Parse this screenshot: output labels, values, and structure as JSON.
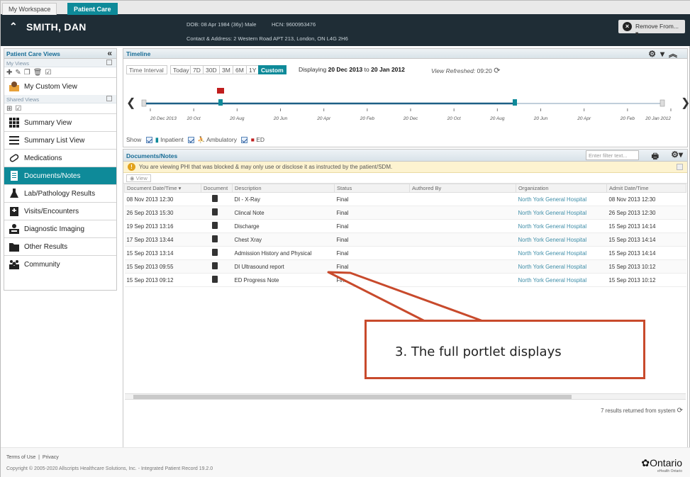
{
  "tabs": [
    "My Workspace",
    "Patient Care"
  ],
  "patient": {
    "name": "SMITH, DAN",
    "demo": "DOB:  08 Apr 1984 (36y)  Male",
    "hcn": "HCN:  9600953476",
    "address": "Contact & Address:  2 Western Road APT 213, London, ON L4G 2H6",
    "remove_label": "Remove From..."
  },
  "left": {
    "title": "Patient Care Views",
    "my_views": "My Views",
    "my_custom_view": "My Custom View",
    "shared_views": "Shared Views",
    "items": [
      "Summary View",
      "Summary List View",
      "Medications",
      "Documents/Notes",
      "Lab/Pathology Results",
      "Visits/Encounters",
      "Diagnostic Imaging",
      "Other Results",
      "Community"
    ]
  },
  "timeline": {
    "title": "Timeline",
    "interval_label": "Time Interval",
    "buttons": [
      "Today",
      "7D",
      "30D",
      "3M",
      "6M",
      "1Y",
      "Custom"
    ],
    "display_prefix": "Displaying",
    "date_from": "20 Dec 2013",
    "display_to": "to",
    "date_to": "20 Jan 2012",
    "refreshed_label": "View Refreshed:",
    "refreshed_time": "09:20",
    "ticks": [
      "20 Dec 2013",
      "20 Oct",
      "20 Aug",
      "20 Jun",
      "20 Apr",
      "20 Feb",
      "20 Dec",
      "20 Oct",
      "20 Aug",
      "20 Jun",
      "20 Apr",
      "20 Feb",
      "20 Jan 2012"
    ],
    "show_label": "Show",
    "legend": [
      "Inpatient",
      "Ambulatory",
      "ED"
    ]
  },
  "docs": {
    "title": "Documents/Notes",
    "filter_placeholder": "Enter filter text...",
    "warning": "You are viewing PHI that was blocked & may only use or disclose it as instructed by the patient/SDM.",
    "view_label": "View",
    "columns": [
      "Document Date/Time",
      "Document",
      "Description",
      "Status",
      "Authored By",
      "Organization",
      "Admit Date/Time"
    ],
    "rows": [
      {
        "date": "08 Nov 2013 12:30",
        "desc": "DI - X-Ray",
        "status": "Final",
        "org": "North York General Hospital",
        "admit": "08 Nov 2013 12:30"
      },
      {
        "date": "26 Sep 2013 15:30",
        "desc": "Clincal Note",
        "status": "Final",
        "org": "North York General Hospital",
        "admit": "26 Sep 2013 12:30"
      },
      {
        "date": "19 Sep 2013 13:16",
        "desc": "Discharge",
        "status": "Final",
        "org": "North York General Hospital",
        "admit": "15 Sep 2013 14:14"
      },
      {
        "date": "17 Sep 2013 13:44",
        "desc": "Chest Xray",
        "status": "Final",
        "org": "North York General Hospital",
        "admit": "15 Sep 2013 14:14"
      },
      {
        "date": "15 Sep 2013 13:14",
        "desc": "Admission History and Physical",
        "status": "Final",
        "org": "North York General Hospital",
        "admit": "15 Sep 2013 14:14"
      },
      {
        "date": "15 Sep 2013 09:55",
        "desc": "DI Ultrasound report",
        "status": "Final",
        "org": "North York General Hospital",
        "admit": "15 Sep 2013 10:12"
      },
      {
        "date": "15 Sep 2013 09:12",
        "desc": "ED Progress Note",
        "status": "Final",
        "org": "North York General Hospital",
        "admit": "15 Sep 2013 10:12"
      }
    ],
    "results": "7 results returned from system"
  },
  "callout": "3. The full portlet displays",
  "footer": {
    "terms": "Terms of Use",
    "privacy": "Privacy",
    "copyright": "Copyright © 2005-2020 Allscripts Healthcare Solutions, Inc. - Integrated Patient Record 19.2.0",
    "logo": "Ontario",
    "logo_sub": "eHealth Ontario"
  },
  "colors": {
    "teal": "#0e8a99",
    "banner": "#1f2d36",
    "callout": "#c84a2c"
  }
}
